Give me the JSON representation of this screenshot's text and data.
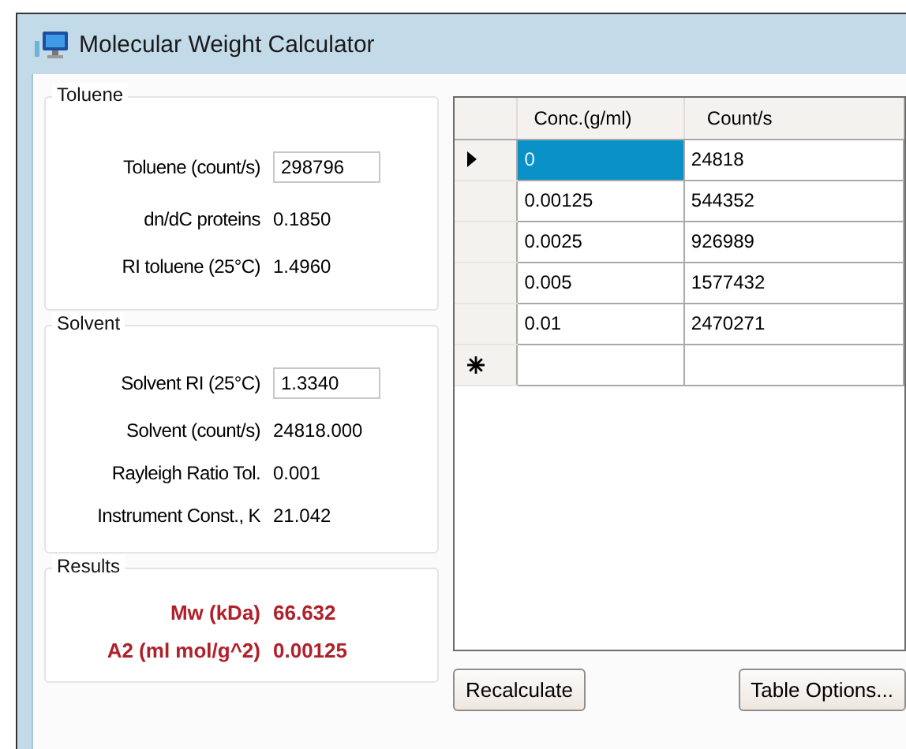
{
  "window": {
    "title": "Molecular Weight Calculator"
  },
  "groups": [
    {
      "title": "Toluene",
      "rows": [
        {
          "kind": "input",
          "label": "Toluene (count/s)",
          "value": "298796"
        },
        {
          "kind": "text",
          "label": "dn/dC proteins",
          "value": "0.1850"
        },
        {
          "kind": "text",
          "label": "RI toluene (25°C)",
          "value": "1.4960"
        }
      ]
    },
    {
      "title": "Solvent",
      "rows": [
        {
          "kind": "input",
          "label": "Solvent RI (25°C)",
          "value": "1.3340"
        },
        {
          "kind": "text",
          "label": "Solvent (count/s)",
          "value": "24818.000"
        },
        {
          "kind": "text",
          "label": "Rayleigh Ratio Tol.",
          "value": "0.001"
        },
        {
          "kind": "text",
          "label": "Instrument Const., K",
          "value": "21.042"
        }
      ]
    },
    {
      "title": "Results",
      "rows": [
        {
          "kind": "result",
          "label": "Mw (kDa)",
          "value": "66.632"
        },
        {
          "kind": "result",
          "label": "A2 (ml mol/g^2)",
          "value": "0.00125"
        }
      ]
    }
  ],
  "grid": {
    "columns": [
      "Conc.(g/ml)",
      "Count/s"
    ],
    "rows": [
      {
        "current": true,
        "cells": [
          {
            "text": "0",
            "selected": true
          },
          {
            "text": "24818",
            "selected": false
          }
        ]
      },
      {
        "current": false,
        "cells": [
          {
            "text": "0.00125",
            "selected": false
          },
          {
            "text": "544352",
            "selected": false
          }
        ]
      },
      {
        "current": false,
        "cells": [
          {
            "text": "0.0025",
            "selected": false
          },
          {
            "text": "926989",
            "selected": false
          }
        ]
      },
      {
        "current": false,
        "cells": [
          {
            "text": "0.005",
            "selected": false
          },
          {
            "text": "1577432",
            "selected": false
          }
        ]
      },
      {
        "current": false,
        "cells": [
          {
            "text": "0.01",
            "selected": false
          },
          {
            "text": "2470271",
            "selected": false
          }
        ]
      }
    ],
    "new_row": true
  },
  "buttons": [
    "Recalculate",
    "Table Options..."
  ]
}
